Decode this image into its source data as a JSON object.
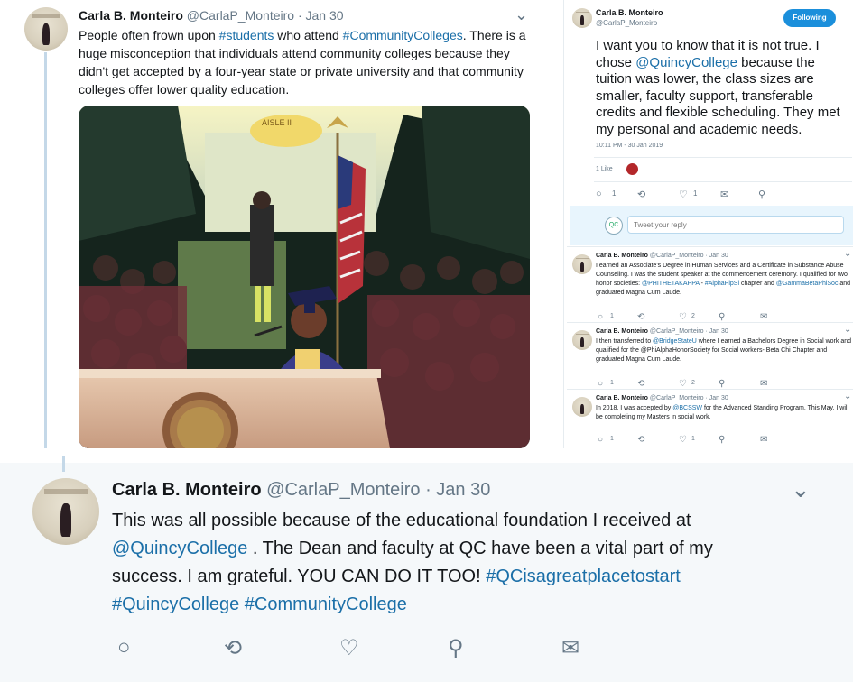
{
  "tweet1": {
    "name": "Carla B. Monteiro",
    "handle": "@CarlaP_Monteiro · Jan 30",
    "text": [
      {
        "t": "People often frown upon "
      },
      {
        "t": "#students",
        "link": true
      },
      {
        "t": " who attend "
      },
      {
        "t": "#CommunityColleges",
        "link": true
      },
      {
        "t": ". There is a huge misconception that individuals attend community colleges because they didn't get accepted by a four-year state or private university and that community colleges offer lower quality education."
      }
    ],
    "photo_sign": "AISLE II"
  },
  "tweet2": {
    "name": "Carla B. Monteiro",
    "handle": "@CarlaP_Monteiro",
    "follow_label": "Following",
    "text": [
      {
        "t": "I want you to know that it is not true. I chose "
      },
      {
        "t": "@QuincyCollege",
        "link": true
      },
      {
        "t": " because the tuition was lower, the class sizes are smaller, faculty support, transferable credits and flexible scheduling. They met my personal and academic needs."
      }
    ],
    "time": "10:11 PM - 30 Jan 2019",
    "likes": "1 Like",
    "actions": {
      "reply": "1",
      "retweet": "",
      "like": "1"
    },
    "reply_placeholder": "Tweet your reply"
  },
  "replies": [
    {
      "name": "Carla B. Monteiro",
      "handle": "@CarlaP_Monteiro · Jan 30",
      "text": [
        {
          "t": "I earned an Associate's Degree in Human Services and a Certificate in Substance Abuse Counseling. I was the student speaker at the commencement ceremony. I qualified for two honor societies: "
        },
        {
          "t": "@PHITHETAKAPPA",
          "link": true
        },
        {
          "t": " - "
        },
        {
          "t": "#AlphaPipSi",
          "link": true
        },
        {
          "t": " chapter and "
        },
        {
          "t": "@GammaBetaPhiSoc",
          "link": true
        },
        {
          "t": " and graduated Magna Cum Laude."
        }
      ],
      "counts": {
        "reply": "1",
        "retweet": "",
        "like": "2"
      }
    },
    {
      "name": "Carla B. Monteiro",
      "handle": "@CarlaP_Monteiro · Jan 30",
      "text": [
        {
          "t": "I then transferred to "
        },
        {
          "t": "@BridgeStateU",
          "link": true
        },
        {
          "t": " where I earned a Bachelors Degree in Social work and qualified for the @PhiAlphaHonorSociety for Social workers- Beta Chi Chapter and graduated Magna Cum Laude."
        }
      ],
      "counts": {
        "reply": "1",
        "retweet": "",
        "like": "2"
      }
    },
    {
      "name": "Carla B. Monteiro",
      "handle": "@CarlaP_Monteiro · Jan 30",
      "text": [
        {
          "t": "In 2018, I was accepted by "
        },
        {
          "t": "@BCSSW",
          "link": true
        },
        {
          "t": " for the Advanced Standing Program. This May, I will be completing my Masters in social work."
        }
      ],
      "counts": {
        "reply": "1",
        "retweet": "",
        "like": "1"
      }
    }
  ],
  "tweet3": {
    "name": "Carla B. Monteiro",
    "handle": "@CarlaP_Monteiro · Jan 30",
    "text": [
      {
        "t": "This was all possible because of the educational foundation I received at "
      },
      {
        "t": "@QuincyCollege",
        "link": true
      },
      {
        "t": " . The Dean and faculty at QC have been a vital part of my success. I am grateful. YOU CAN DO IT TOO! "
      },
      {
        "t": "#QCisagreatplacetostart",
        "link": true
      },
      {
        "t": " "
      },
      {
        "t": "#QuincyCollege",
        "link": true
      },
      {
        "t": " "
      },
      {
        "t": "#CommunityCollege",
        "link": true
      }
    ]
  },
  "icons": [
    "reply-icon",
    "retweet-icon",
    "like-icon",
    "analytics-icon",
    "message-icon",
    "chevron-down-icon"
  ]
}
